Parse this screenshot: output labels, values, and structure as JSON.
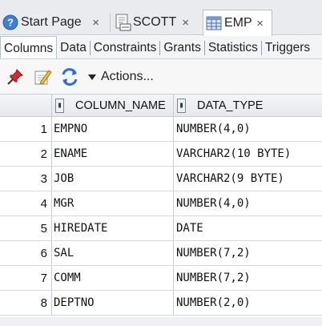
{
  "doc_tabs": [
    {
      "label": "Start Page",
      "icon": "help-icon",
      "close": "×"
    },
    {
      "label": "SCOTT",
      "icon": "sql-connection-icon",
      "close": "×"
    },
    {
      "label": "EMP",
      "icon": "table-icon",
      "close": "×"
    }
  ],
  "sub_tabs": [
    "Columns",
    "Data",
    "Constraints",
    "Grants",
    "Statistics",
    "Triggers"
  ],
  "toolbar": {
    "actions_label": "Actions..."
  },
  "grid": {
    "headers": [
      "COLUMN_NAME",
      "DATA_TYPE"
    ],
    "rows": [
      {
        "num": "1",
        "column_name": "EMPNO",
        "data_type": "NUMBER(4,0)"
      },
      {
        "num": "2",
        "column_name": "ENAME",
        "data_type": "VARCHAR2(10 BYTE)"
      },
      {
        "num": "3",
        "column_name": "JOB",
        "data_type": "VARCHAR2(9 BYTE)"
      },
      {
        "num": "4",
        "column_name": "MGR",
        "data_type": "NUMBER(4,0)"
      },
      {
        "num": "5",
        "column_name": "HIREDATE",
        "data_type": "DATE"
      },
      {
        "num": "6",
        "column_name": "SAL",
        "data_type": "NUMBER(7,2)"
      },
      {
        "num": "7",
        "column_name": "COMM",
        "data_type": "NUMBER(7,2)"
      },
      {
        "num": "8",
        "column_name": "DEPTNO",
        "data_type": "NUMBER(2,0)"
      }
    ]
  }
}
